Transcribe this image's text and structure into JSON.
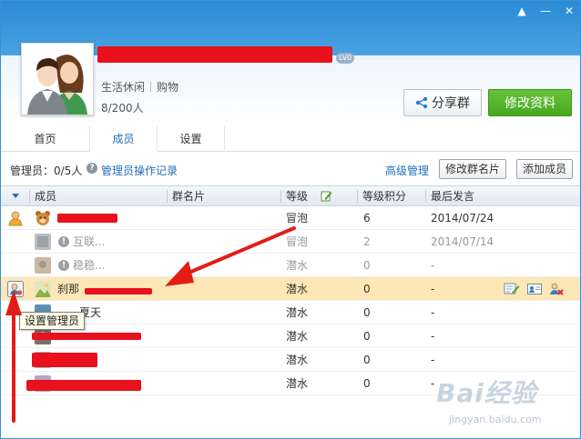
{
  "window": {
    "controls": [
      "▲",
      "—",
      "✕"
    ]
  },
  "group": {
    "level": "LV0",
    "tags": [
      "生活休闲",
      "购物"
    ],
    "count": "8/200人"
  },
  "buttons": {
    "share": "分享群",
    "edit": "修改资料"
  },
  "tabs": [
    "首页",
    "成员",
    "设置"
  ],
  "admin": {
    "label": "管理员：0/5人",
    "ops_link": "管理员操作记录",
    "advanced": "高级管理",
    "edit_card": "修改群名片",
    "add_member": "添加成员"
  },
  "table": {
    "headers": [
      "成员",
      "群名片",
      "等级",
      "等级积分",
      "最后发言"
    ],
    "rows": [
      {
        "name": "",
        "level": "冒泡",
        "points": "6",
        "last": "2014/07/24",
        "role": "owner",
        "state": "normal"
      },
      {
        "name": "互联...",
        "level": "冒泡",
        "points": "2",
        "last": "2014/07/14",
        "role": "",
        "state": "grey"
      },
      {
        "name": "稳稳...",
        "level": "潜水",
        "points": "0",
        "last": "-",
        "role": "",
        "state": "grey"
      },
      {
        "name": "刹那",
        "level": "潜水",
        "points": "0",
        "last": "-",
        "role": "set-admin",
        "state": "selected"
      },
      {
        "name": "夏天",
        "level": "潜水",
        "points": "0",
        "last": "-",
        "role": "",
        "state": "normal"
      },
      {
        "name": "",
        "level": "潜水",
        "points": "0",
        "last": "-",
        "role": "",
        "state": "normal"
      },
      {
        "name": "",
        "level": "潜水",
        "points": "0",
        "last": "-",
        "role": "",
        "state": "normal"
      },
      {
        "name": "",
        "level": "潜水",
        "points": "0",
        "last": "-",
        "role": "",
        "state": "normal"
      }
    ]
  },
  "tooltip": "设置管理员",
  "watermark": {
    "main": "Bai经验",
    "sub": "jingyan.baidu.com"
  },
  "colors": {
    "accent": "#2a8bd6",
    "green": "#52b52a",
    "link": "#1f6fb6",
    "redact": "#e8111d",
    "selected": "#fde7b6"
  }
}
